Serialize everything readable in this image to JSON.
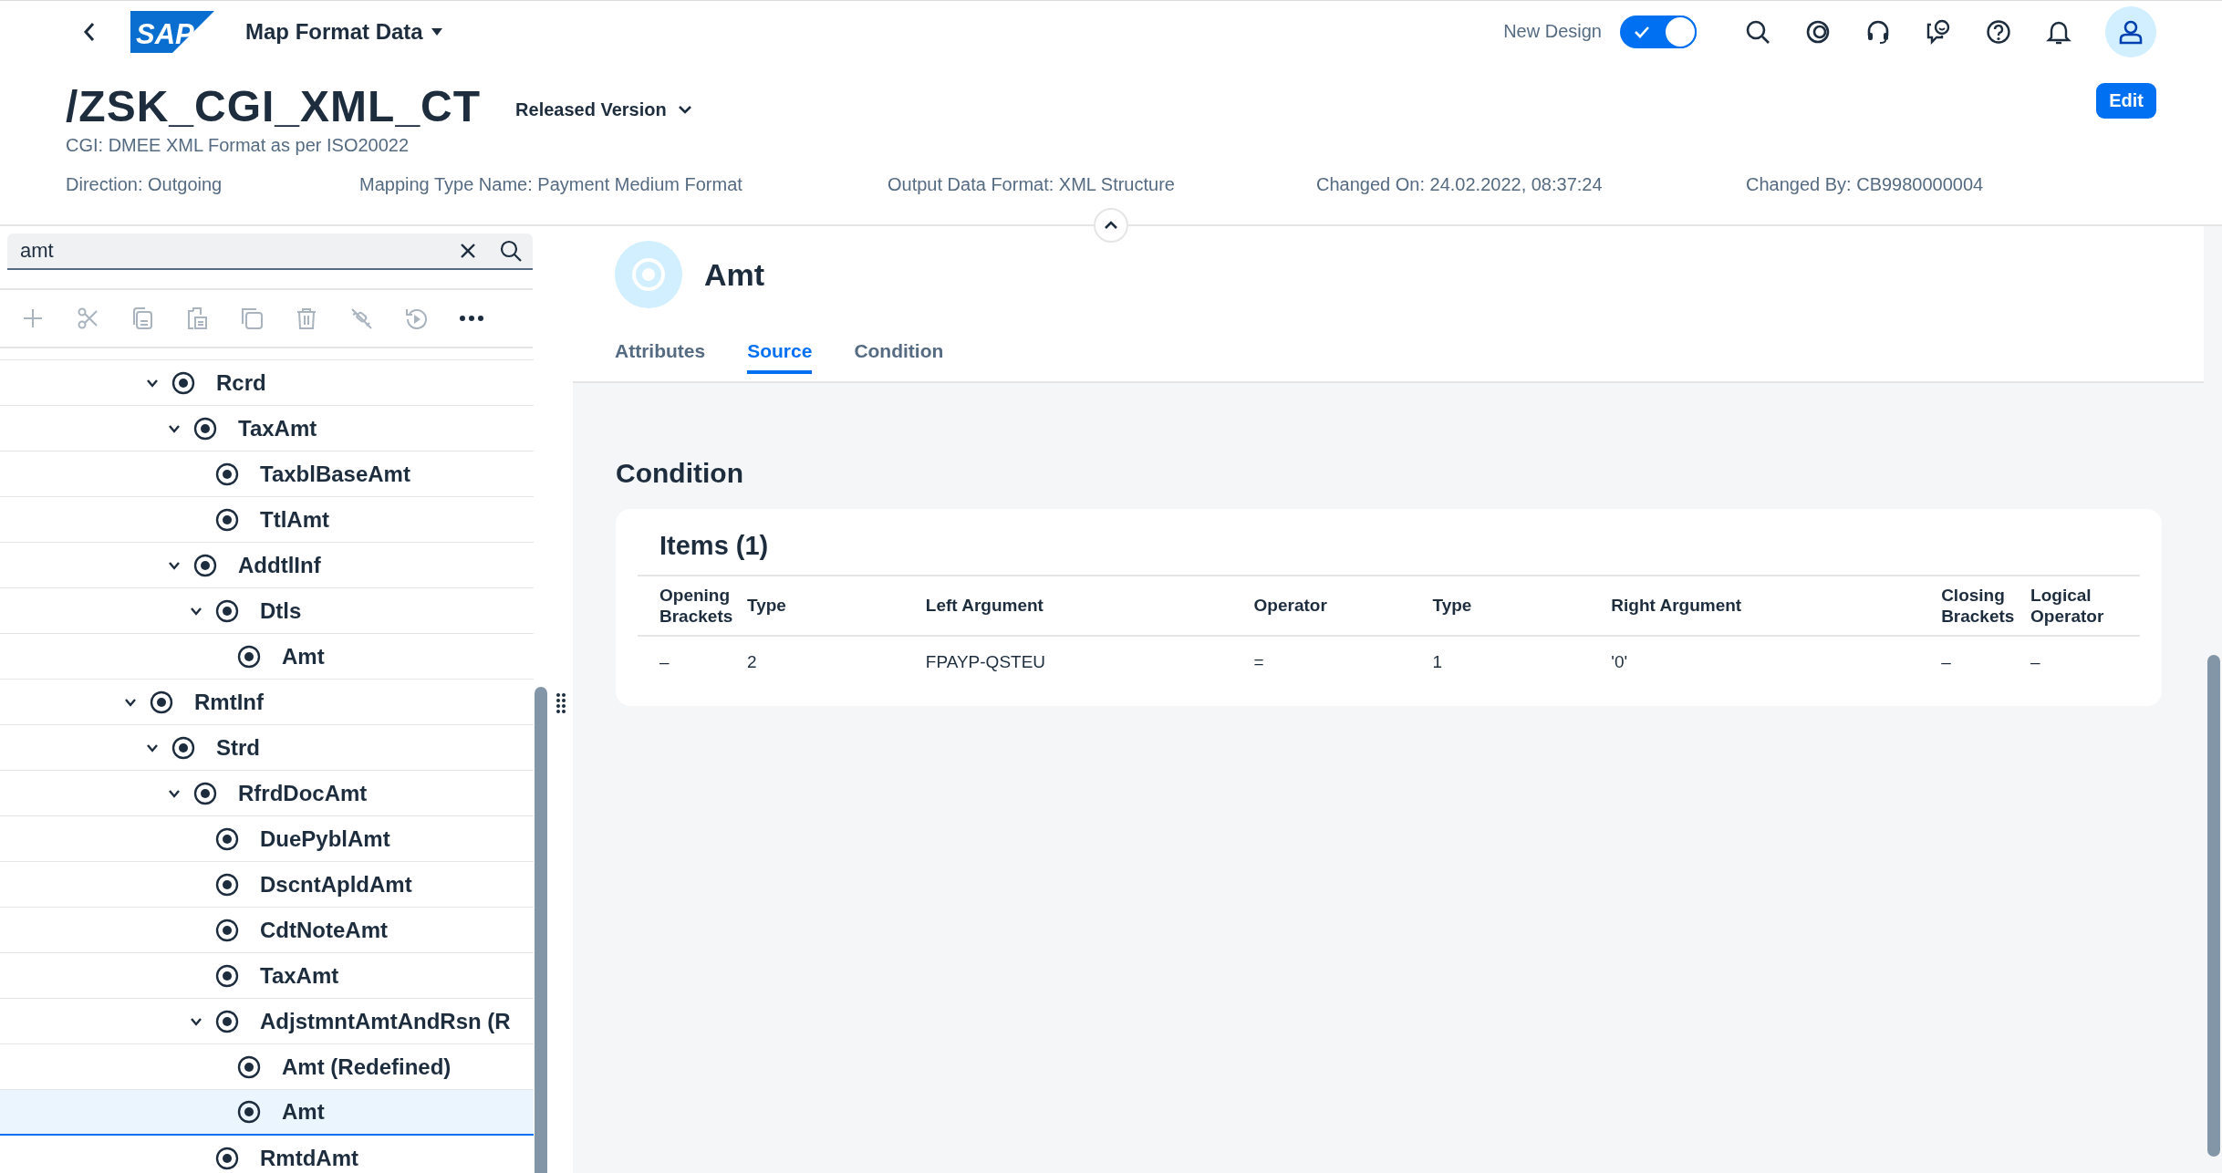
{
  "shell": {
    "logo": "SAP",
    "app_title": "Map Format Data",
    "new_design": {
      "label": "New Design",
      "on": true
    }
  },
  "header": {
    "title": "/ZSK_CGI_XML_CT",
    "version": "Released Version",
    "subtitle": "CGI: DMEE XML Format as per ISO20022",
    "edit_button": "Edit",
    "attributes": [
      "Direction: Outgoing",
      "Mapping Type Name: Payment Medium Format",
      "Output Data Format: XML Structure",
      "Changed On: 24.02.2022, 08:37:24",
      "Changed By: CB9980000004"
    ]
  },
  "search": {
    "value": "amt"
  },
  "tree": {
    "items": [
      {
        "children": [
          {
            "label": "Rcrd",
            "expanded": true,
            "selected": false,
            "children": [
              {
                "label": "TaxAmt",
                "expanded": true,
                "selected": false,
                "children": [
                  {
                    "label": "TaxblBaseAmt",
                    "selected": false
                  },
                  {
                    "label": "TtlAmt",
                    "selected": false
                  }
                ]
              },
              {
                "label": "AddtlInf",
                "expanded": true,
                "selected": false,
                "children": [
                  {
                    "label": "Dtls",
                    "expanded": true,
                    "selected": false,
                    "children": [
                      {
                        "label": "Amt",
                        "selected": false
                      }
                    ]
                  }
                ]
              }
            ]
          }
        ]
      },
      {
        "label": "RmtInf",
        "expanded": true,
        "selected": false,
        "children": [
          {
            "label": "Strd",
            "expanded": true,
            "selected": false,
            "children": [
              {
                "label": "RfrdDocAmt",
                "expanded": true,
                "selected": false,
                "children": [
                  {
                    "label": "DuePyblAmt",
                    "selected": false
                  },
                  {
                    "label": "DscntApldAmt",
                    "selected": false
                  },
                  {
                    "label": "CdtNoteAmt",
                    "selected": false
                  },
                  {
                    "label": "TaxAmt",
                    "selected": false
                  },
                  {
                    "label": "AdjstmntAmtAndRsn (R",
                    "expanded": true,
                    "selected": false,
                    "children": [
                      {
                        "label": "Amt (Redefined)",
                        "selected": false
                      },
                      {
                        "label": "Amt",
                        "selected": true
                      }
                    ]
                  },
                  {
                    "label": "RmtdAmt",
                    "selected": false
                  }
                ]
              }
            ]
          }
        ]
      }
    ]
  },
  "detail": {
    "title": "Amt",
    "tabs": [
      {
        "label": "Attributes",
        "selected": false
      },
      {
        "label": "Source",
        "selected": true
      },
      {
        "label": "Condition",
        "selected": false
      }
    ],
    "section_title": "Condition",
    "table": {
      "title": "Items (1)",
      "columns": [
        "Opening Brackets",
        "Type",
        "Left Argument",
        "Operator",
        "Type",
        "Right Argument",
        "Closing Brackets",
        "Logical Operator"
      ],
      "rows": [
        [
          "–",
          "2",
          "FPAYP-QSTEU",
          "=",
          "1",
          "'0'",
          "–",
          "–"
        ]
      ]
    }
  }
}
